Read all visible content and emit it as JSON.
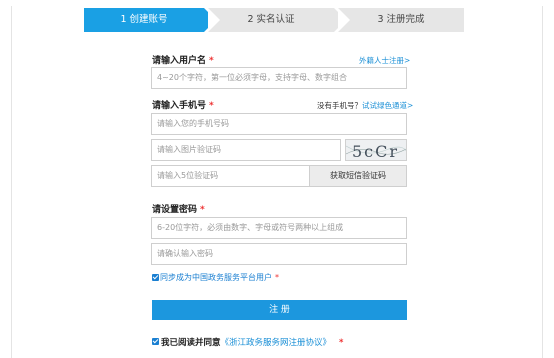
{
  "steps": [
    {
      "label": "1 创建账号",
      "active": true
    },
    {
      "label": "2 实名认证",
      "active": false
    },
    {
      "label": "3 注册完成",
      "active": false
    }
  ],
  "username": {
    "label": "请输入用户名",
    "required": "*",
    "foreign_link": "外籍人士注册>",
    "placeholder": "4~20个字符，第一位必须字母，支持字母、数字组合"
  },
  "phone": {
    "label": "请输入手机号",
    "required": "*",
    "no_phone_text": "没有手机号？",
    "green_channel_link": "试试绿色通道>",
    "placeholder": "请输入您的手机号码"
  },
  "image_code": {
    "placeholder": "请输入图片验证码",
    "captcha_text": "5cCr"
  },
  "sms_code": {
    "placeholder": "请输入5位验证码",
    "button": "获取短信验证码"
  },
  "password": {
    "label": "请设置密码",
    "required": "*",
    "placeholder": "6-20位字符，必须由数字、字母或符号两种以上组成",
    "confirm_placeholder": "请确认输入密码"
  },
  "sync_option": {
    "label": "同步成为中国政务服务平台用户",
    "required": "*",
    "checked": true
  },
  "submit": {
    "label": "注 册"
  },
  "agreement": {
    "prefix": "我已阅读并同意",
    "link": "《浙江政务服务网注册协议》",
    "required": "*",
    "checked": true
  },
  "colors": {
    "accent": "#1aa0e4",
    "button": "#1c97de",
    "required": "#e33333"
  }
}
